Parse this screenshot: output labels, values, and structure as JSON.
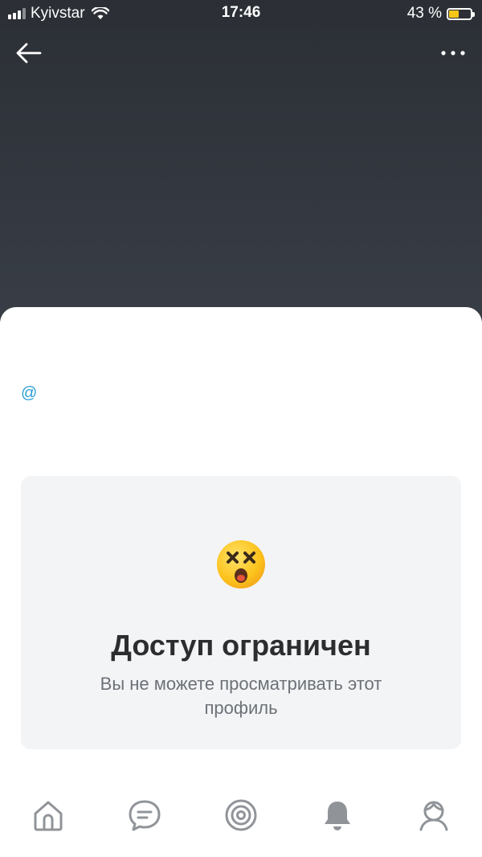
{
  "status_bar": {
    "carrier": "Kyivstar",
    "time": "17:46",
    "battery_percent": "43 %",
    "battery_level": 0.43
  },
  "profile": {
    "handle": "@"
  },
  "restricted_card": {
    "title": "Доступ ограничен",
    "message": "Вы не можете просматривать этот профиль",
    "emoji": "dizzy-face-icon"
  },
  "tab_bar": {
    "items": [
      {
        "icon": "home-icon"
      },
      {
        "icon": "messages-icon"
      },
      {
        "icon": "discover-icon"
      },
      {
        "icon": "notifications-icon"
      },
      {
        "icon": "profile-icon"
      }
    ]
  },
  "colors": {
    "header_bg": "#2b2f35",
    "accent_link": "#2a9fd6",
    "card_bg": "#f3f4f6",
    "battery_fill": "#f5c518",
    "icon_gray": "#909499"
  }
}
